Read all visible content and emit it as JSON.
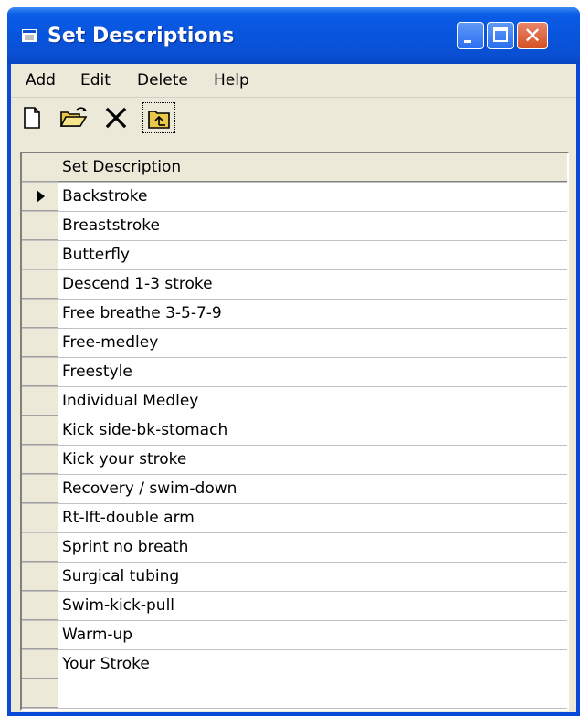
{
  "window": {
    "title": "Set Descriptions"
  },
  "menu": {
    "items": [
      "Add",
      "Edit",
      "Delete",
      "Help"
    ]
  },
  "toolbar": {
    "icons": [
      "new-document-icon",
      "open-folder-icon",
      "delete-icon",
      "up-one-level-icon"
    ]
  },
  "grid": {
    "column_header": "Set Description",
    "current_row_index": 0,
    "rows": [
      "Backstroke",
      "Breaststroke",
      "Butterfly",
      "Descend 1-3 stroke",
      "Free breathe 3-5-7-9",
      "Free-medley",
      "Freestyle",
      "Individual Medley",
      "Kick side-bk-stomach",
      "Kick your stroke",
      "Recovery / swim-down",
      "Rt-lft-double arm",
      "Sprint no breath",
      "Surgical tubing",
      "Swim-kick-pull",
      "Warm-up",
      "Your Stroke"
    ]
  },
  "colors": {
    "titlebar": "#0855dd",
    "window_bg": "#ece9d8",
    "close_button": "#d64f22"
  }
}
